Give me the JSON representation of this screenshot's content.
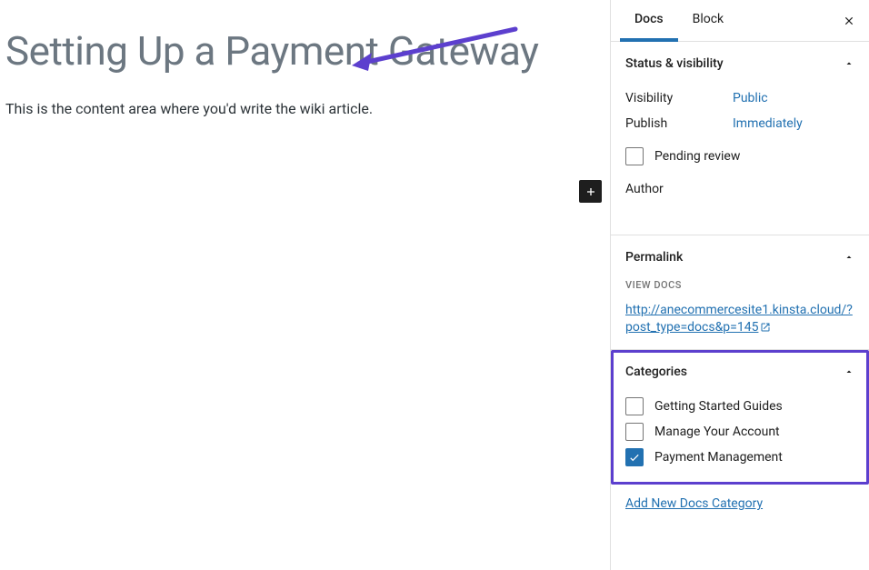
{
  "editor": {
    "title": "Setting Up a Payment Gateway",
    "content": "This is the content area where you'd write the wiki article."
  },
  "sidebar": {
    "tabs": {
      "docs": "Docs",
      "block": "Block"
    },
    "status": {
      "heading": "Status & visibility",
      "visibility_label": "Visibility",
      "visibility_value": "Public",
      "publish_label": "Publish",
      "publish_value": "Immediately",
      "pending_review": "Pending review",
      "author_label": "Author"
    },
    "permalink": {
      "heading": "Permalink",
      "view_label": "VIEW DOCS",
      "url": "http://anecommercesite1.kinsta.cloud/?post_type=docs&p=145"
    },
    "categories": {
      "heading": "Categories",
      "items": {
        "0": {
          "label": "Getting Started Guides"
        },
        "1": {
          "label": "Manage Your Account"
        },
        "2": {
          "label": "Payment Management"
        }
      },
      "add_new": "Add New Docs Category"
    }
  }
}
